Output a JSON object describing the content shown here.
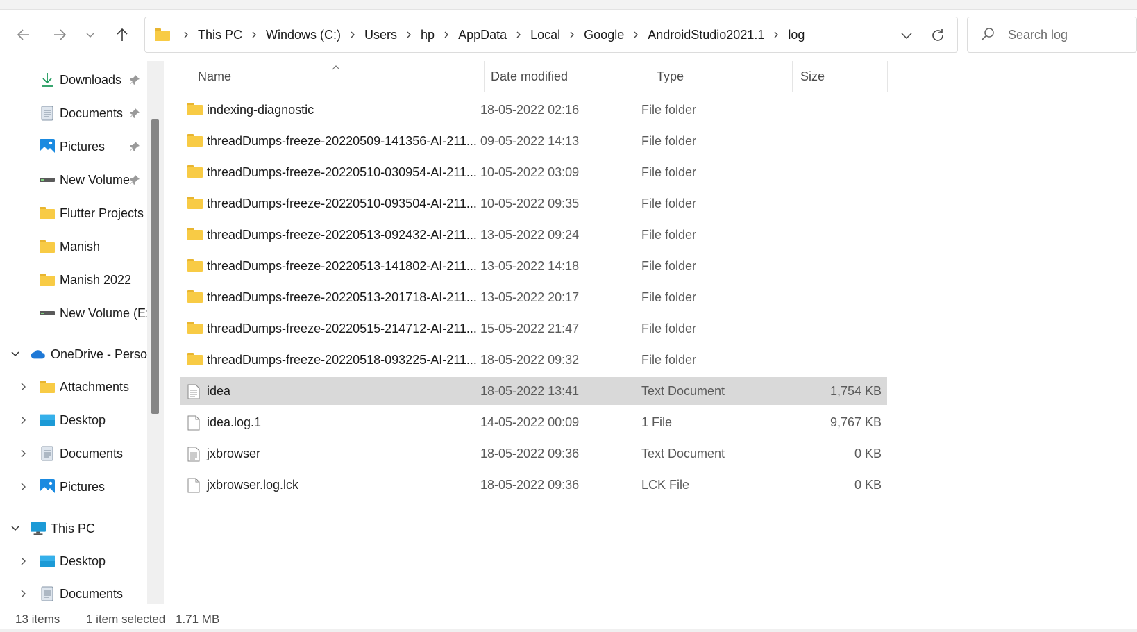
{
  "nav": {
    "back_icon": "arrow-left-icon",
    "forward_icon": "arrow-right-icon",
    "recent_icon": "chevron-down-icon",
    "up_icon": "arrow-up-icon"
  },
  "address": {
    "crumbs": [
      "This PC",
      "Windows (C:)",
      "Users",
      "hp",
      "AppData",
      "Local",
      "Google",
      "AndroidStudio2021.1",
      "log"
    ]
  },
  "search": {
    "placeholder": "Search log"
  },
  "sidebar": {
    "items": [
      {
        "label": "Downloads",
        "icon": "download-icon",
        "pinned": true
      },
      {
        "label": "Documents",
        "icon": "document-icon",
        "pinned": true
      },
      {
        "label": "Pictures",
        "icon": "pictures-icon",
        "pinned": true
      },
      {
        "label": "New Volume",
        "icon": "drive-icon",
        "pinned": true
      },
      {
        "label": "Flutter Projects",
        "icon": "folder-icon",
        "pinned": false
      },
      {
        "label": "Manish",
        "icon": "folder-icon",
        "pinned": false
      },
      {
        "label": "Manish 2022",
        "icon": "folder-icon",
        "pinned": false
      },
      {
        "label": "New Volume (E:",
        "icon": "drive-icon",
        "pinned": false
      },
      {
        "label": "OneDrive - Perso",
        "icon": "cloud-icon",
        "expanded": true
      },
      {
        "label": "Attachments",
        "icon": "folder-icon",
        "expanded": false
      },
      {
        "label": "Desktop",
        "icon": "desktop-icon",
        "expanded": false
      },
      {
        "label": "Documents",
        "icon": "document-icon",
        "expanded": false
      },
      {
        "label": "Pictures",
        "icon": "pictures-icon",
        "expanded": false
      },
      {
        "label": "This PC",
        "icon": "computer-icon",
        "expanded": true
      },
      {
        "label": "Desktop",
        "icon": "desktop-icon",
        "expanded": false
      },
      {
        "label": "Documents",
        "icon": "document-icon",
        "expanded": false
      }
    ]
  },
  "columns": {
    "name": "Name",
    "date": "Date modified",
    "type": "Type",
    "size": "Size"
  },
  "files": [
    {
      "name": "indexing-diagnostic",
      "date": "18-05-2022 02:16",
      "type": "File folder",
      "size": "",
      "icon": "folder-icon"
    },
    {
      "name": "threadDumps-freeze-20220509-141356-AI-211...",
      "date": "09-05-2022 14:13",
      "type": "File folder",
      "size": "",
      "icon": "folder-icon"
    },
    {
      "name": "threadDumps-freeze-20220510-030954-AI-211...",
      "date": "10-05-2022 03:09",
      "type": "File folder",
      "size": "",
      "icon": "folder-icon"
    },
    {
      "name": "threadDumps-freeze-20220510-093504-AI-211...",
      "date": "10-05-2022 09:35",
      "type": "File folder",
      "size": "",
      "icon": "folder-icon"
    },
    {
      "name": "threadDumps-freeze-20220513-092432-AI-211...",
      "date": "13-05-2022 09:24",
      "type": "File folder",
      "size": "",
      "icon": "folder-icon"
    },
    {
      "name": "threadDumps-freeze-20220513-141802-AI-211...",
      "date": "13-05-2022 14:18",
      "type": "File folder",
      "size": "",
      "icon": "folder-icon"
    },
    {
      "name": "threadDumps-freeze-20220513-201718-AI-211...",
      "date": "13-05-2022 20:17",
      "type": "File folder",
      "size": "",
      "icon": "folder-icon"
    },
    {
      "name": "threadDumps-freeze-20220515-214712-AI-211...",
      "date": "15-05-2022 21:47",
      "type": "File folder",
      "size": "",
      "icon": "folder-icon"
    },
    {
      "name": "threadDumps-freeze-20220518-093225-AI-211...",
      "date": "18-05-2022 09:32",
      "type": "File folder",
      "size": "",
      "icon": "folder-icon"
    },
    {
      "name": "idea",
      "date": "18-05-2022 13:41",
      "type": "Text Document",
      "size": "1,754 KB",
      "icon": "text-file-icon",
      "selected": true
    },
    {
      "name": "idea.log.1",
      "date": "14-05-2022 00:09",
      "type": "1 File",
      "size": "9,767 KB",
      "icon": "file-icon"
    },
    {
      "name": "jxbrowser",
      "date": "18-05-2022 09:36",
      "type": "Text Document",
      "size": "0 KB",
      "icon": "text-file-icon"
    },
    {
      "name": "jxbrowser.log.lck",
      "date": "18-05-2022 09:36",
      "type": "LCK File",
      "size": "0 KB",
      "icon": "file-icon"
    }
  ],
  "status": {
    "count": "13 items",
    "selection": "1 item selected",
    "size": "1.71 MB"
  },
  "colors": {
    "folder": "#f8cb45",
    "selected_row": "#d9d9d9",
    "onedrive": "#1e78d6",
    "accent": "#0078d4"
  }
}
